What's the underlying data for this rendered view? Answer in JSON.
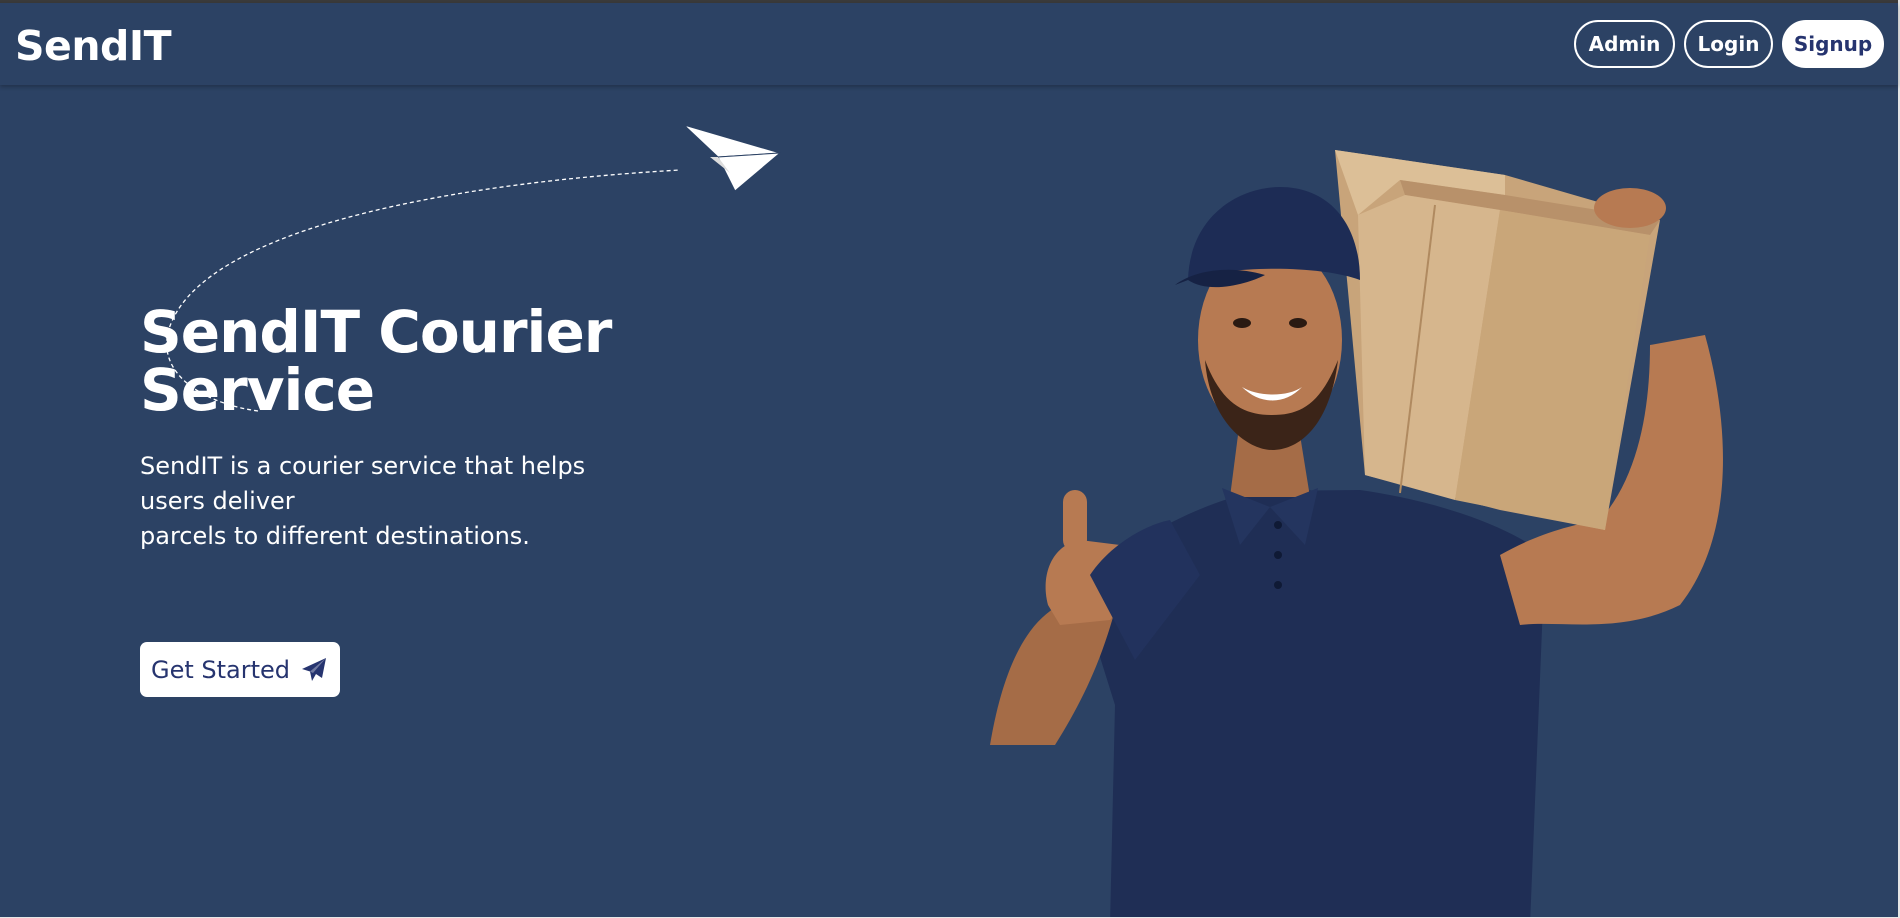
{
  "header": {
    "brand": "SendIT",
    "nav": [
      {
        "label": "Admin",
        "style": "outline"
      },
      {
        "label": "Login",
        "style": "outline"
      },
      {
        "label": "Signup",
        "style": "solid"
      }
    ]
  },
  "hero": {
    "title": "SendIT Courier Service",
    "description_lines": [
      "SendIT is a courier service that helps",
      "users deliver",
      "parcels to different destinations."
    ],
    "cta_label": "Get Started",
    "cta_icon": "paper-plane-icon",
    "decoration_icon": "paper-plane-icon",
    "image": "courier-man-holding-box-thumbs-up"
  },
  "colors": {
    "background": "#2c4264",
    "accent": "#26346f",
    "text": "#ffffff"
  }
}
